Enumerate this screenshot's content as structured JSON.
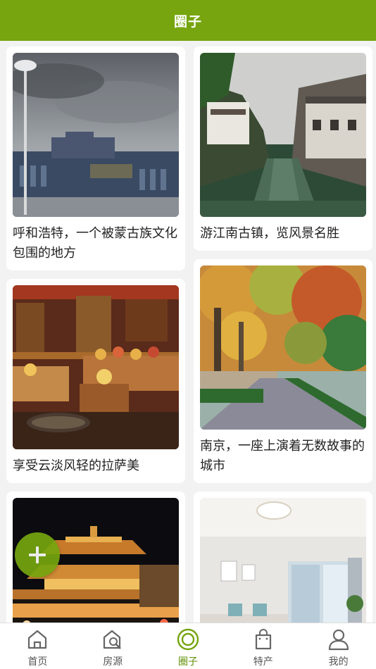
{
  "header": {
    "title": "圈子"
  },
  "posts": [
    {
      "title": "呼和浩特，一个被蒙古族文化包围的地方",
      "image": "city-building-cloudy-sky"
    },
    {
      "title": "游江南古镇，览风景名胜",
      "image": "water-town-canal"
    },
    {
      "title": "享受云淡风轻的拉萨美",
      "image": "tibetan-interior"
    },
    {
      "title": "南京，一座上演着无数故事的城市",
      "image": "autumn-tree-road"
    },
    {
      "title": "",
      "image": "night-bell-tower"
    },
    {
      "title": "",
      "image": "bright-living-room"
    }
  ],
  "fab": {
    "icon": "plus-icon"
  },
  "tabbar": {
    "items": [
      {
        "label": "首页",
        "icon": "home-icon"
      },
      {
        "label": "房源",
        "icon": "house-search-icon"
      },
      {
        "label": "圈子",
        "icon": "circle-target-icon",
        "active": true
      },
      {
        "label": "特产",
        "icon": "shopping-bag-icon"
      },
      {
        "label": "我的",
        "icon": "user-icon"
      }
    ]
  },
  "colors": {
    "accent": "#76a50f",
    "background": "#f2f2f2"
  }
}
